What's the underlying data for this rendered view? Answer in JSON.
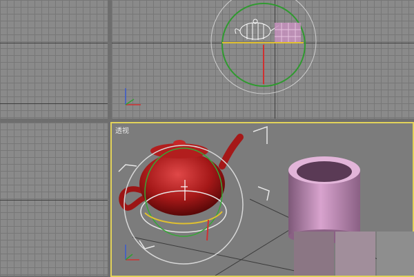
{
  "viewports": {
    "top_left": {
      "name": "top-left"
    },
    "top_right": {
      "name": "top-right"
    },
    "bottom_left": {
      "name": "bottom-left"
    },
    "perspective": {
      "label": "透视"
    }
  },
  "colors": {
    "active_border": "#e3d35a",
    "teapot_red": "#b01a1a",
    "cup_pink": "#c58ab8",
    "gizmo_green": "#3aa83a",
    "gizmo_red": "#d03030",
    "gizmo_yellow": "#e0c030",
    "gizmo_white": "#e8e8e8"
  },
  "icons": [
    "axis-tripod-icon",
    "transform-gizmo-icon"
  ]
}
